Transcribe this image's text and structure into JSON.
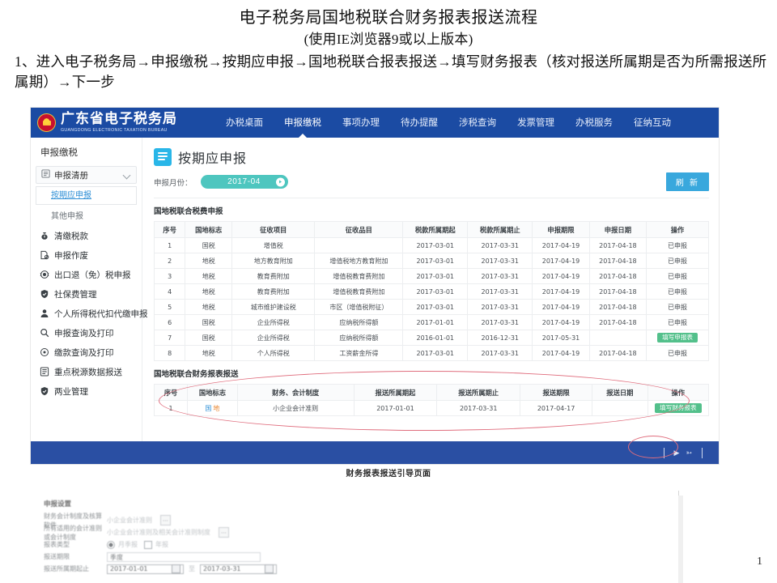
{
  "slide": {
    "title": "电子税务局国地税联合财务报表报送流程",
    "subtitle": "(使用IE浏览器9或以上版本)",
    "step": "1、进入电子税务局→申报缴税→按期应申报→国地税联合报表报送→填写财务报表（核对报送所属期是否为所需报送所属期）→下一步",
    "caption": "财务报表报送引导页面",
    "page_number": "1"
  },
  "app": {
    "brand_cn": "广东省电子税务局",
    "brand_en": "GUANGDONG ELECTRONIC TAXATION BUREAU",
    "nav": [
      {
        "label": "办税桌面",
        "active": false
      },
      {
        "label": "申报缴税",
        "active": true
      },
      {
        "label": "事项办理",
        "active": false
      },
      {
        "label": "待办提醒",
        "active": false
      },
      {
        "label": "涉税查询",
        "active": false
      },
      {
        "label": "发票管理",
        "active": false
      },
      {
        "label": "办税服务",
        "active": false
      },
      {
        "label": "征纳互动",
        "active": false
      }
    ]
  },
  "sidebar": {
    "heading": "申报缴税",
    "group_label": "申报清册",
    "sub_items": [
      {
        "label": "按期应申报",
        "selected": true
      },
      {
        "label": "其他申报",
        "selected": false
      }
    ],
    "items": [
      {
        "label": "清缴税款",
        "icon": "money-bag-icon"
      },
      {
        "label": "申报作废",
        "icon": "document-cancel-icon"
      },
      {
        "label": "出口退（免）税申报",
        "icon": "export-refund-icon"
      },
      {
        "label": "社保费管理",
        "icon": "shield-icon"
      },
      {
        "label": "个人所得税代扣代缴申报",
        "icon": "person-icon"
      },
      {
        "label": "申报查询及打印",
        "icon": "search-icon"
      },
      {
        "label": "缴款查询及打印",
        "icon": "coin-icon"
      },
      {
        "label": "重点税源数据报送",
        "icon": "list-icon"
      },
      {
        "label": "两业管理",
        "icon": "shield-icon"
      }
    ]
  },
  "main": {
    "page_title": "按期应申报",
    "filter_label": "申报月份：",
    "filter_value": "2017-04",
    "refresh_label": "刷 新",
    "section1_title": "国地税联合税费申报",
    "section2_title": "国地税联合财务报表报送",
    "table1": {
      "columns": [
        "序号",
        "国地标志",
        "征收项目",
        "征收品目",
        "税款所属期起",
        "税款所属期止",
        "申报期限",
        "申报日期",
        "操作"
      ],
      "rows": [
        {
          "no": "1",
          "flag": "国税",
          "flag_type": "guo",
          "item": "增值税",
          "sub": "",
          "start": "2017-03-01",
          "end": "2017-03-31",
          "due": "2017-04-19",
          "filed": "2017-04-18",
          "action": "已申报",
          "action_type": "text"
        },
        {
          "no": "2",
          "flag": "地税",
          "flag_type": "di",
          "item": "地方教育附加",
          "sub": "增值税地方教育附加",
          "start": "2017-03-01",
          "end": "2017-03-31",
          "due": "2017-04-19",
          "filed": "2017-04-18",
          "action": "已申报",
          "action_type": "text"
        },
        {
          "no": "3",
          "flag": "地税",
          "flag_type": "di",
          "item": "教育费附加",
          "sub": "增值税教育费附加",
          "start": "2017-03-01",
          "end": "2017-03-31",
          "due": "2017-04-19",
          "filed": "2017-04-18",
          "action": "已申报",
          "action_type": "text"
        },
        {
          "no": "4",
          "flag": "地税",
          "flag_type": "di",
          "item": "教育费附加",
          "sub": "增值税教育费附加",
          "start": "2017-03-01",
          "end": "2017-03-31",
          "due": "2017-04-19",
          "filed": "2017-04-18",
          "action": "已申报",
          "action_type": "text"
        },
        {
          "no": "5",
          "flag": "地税",
          "flag_type": "di",
          "item": "城市维护建设税",
          "sub": "市区（增值税附征）",
          "start": "2017-03-01",
          "end": "2017-03-31",
          "due": "2017-04-19",
          "filed": "2017-04-18",
          "action": "已申报",
          "action_type": "text"
        },
        {
          "no": "6",
          "flag": "国税",
          "flag_type": "guo",
          "item": "企业所得税",
          "sub": "应纳税所得额",
          "start": "2017-01-01",
          "end": "2017-03-31",
          "due": "2017-04-19",
          "filed": "2017-04-18",
          "action": "已申报",
          "action_type": "text"
        },
        {
          "no": "7",
          "flag": "国税",
          "flag_type": "guo",
          "item": "企业所得税",
          "sub": "应纳税所得额",
          "start": "2016-01-01",
          "end": "2016-12-31",
          "due": "2017-05-31",
          "filed": "",
          "action": "填写申报表",
          "action_type": "button"
        },
        {
          "no": "8",
          "flag": "地税",
          "flag_type": "di",
          "item": "个人所得税",
          "sub": "工资薪金所得",
          "start": "2017-03-01",
          "end": "2017-03-31",
          "due": "2017-04-19",
          "filed": "2017-04-18",
          "action": "已申报",
          "action_type": "text"
        }
      ]
    },
    "table2": {
      "columns": [
        "序号",
        "国地标志",
        "财务、会计制度",
        "报送所属期起",
        "报送所属期止",
        "报送期限",
        "报送日期",
        "操作"
      ],
      "rows": [
        {
          "no": "1",
          "flag_guo": "国",
          "flag_di": "地",
          "system": "小企业会计准则",
          "start": "2017-01-01",
          "end": "2017-03-31",
          "due": "2017-04-17",
          "sent": "",
          "action": "填写财务报表"
        }
      ]
    }
  },
  "bottom_form": {
    "title": "申报设置",
    "rows": [
      {
        "label": "财务会计制度及核算软件",
        "value": "小企业会计准则",
        "control": "picker"
      },
      {
        "label": "所有适用的会计准则或会计制度",
        "value": "小企业会计准则及相关会计准则制度",
        "control": "picker"
      },
      {
        "label": "报表类型",
        "value": "",
        "control": "radios",
        "options": [
          "月季报",
          "年报"
        ],
        "selected": "月季报"
      },
      {
        "label": "报送期限",
        "value": "季度",
        "control": "input"
      },
      {
        "label": "报送所属期起止",
        "value_start": "2017-01-01",
        "value_end": "2017-03-31",
        "separator": "至",
        "control": "daterange"
      }
    ]
  },
  "colors": {
    "nav_blue": "#1b4ba3",
    "footer_blue": "#2a4fa3",
    "accent_teal": "#4ec6bf",
    "accent_lightblue": "#39a8dd",
    "accent_green": "#53c08b",
    "tag_guo": "#2e8fd6",
    "tag_di": "#e8822a",
    "annotation_red": "#e06e7e"
  }
}
